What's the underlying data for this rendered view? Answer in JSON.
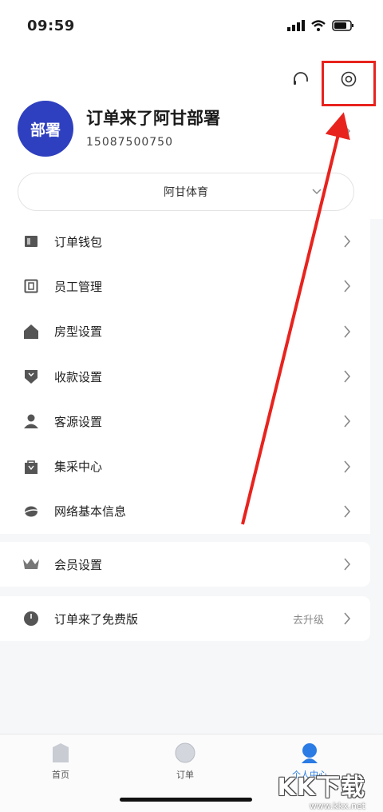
{
  "status_bar": {
    "time": "09:59"
  },
  "profile": {
    "avatar_text": "部署",
    "name": "订单来了阿甘部署",
    "phone": "15087500750",
    "store": "阿甘体育"
  },
  "menu": [
    {
      "id": "wallet",
      "label": "订单钱包",
      "icon": "wallet-icon"
    },
    {
      "id": "staff",
      "label": "员工管理",
      "icon": "staff-icon"
    },
    {
      "id": "room-type",
      "label": "房型设置",
      "icon": "house-icon"
    },
    {
      "id": "payment",
      "label": "收款设置",
      "icon": "payment-icon"
    },
    {
      "id": "customer",
      "label": "客源设置",
      "icon": "person-icon"
    },
    {
      "id": "purchase",
      "label": "集采中心",
      "icon": "bag-icon"
    },
    {
      "id": "network-info",
      "label": "网络基本信息",
      "icon": "globe-icon"
    }
  ],
  "member": {
    "label": "会员设置",
    "icon": "crown-icon"
  },
  "version": {
    "label": "订单来了免费版",
    "extra": "去升级",
    "icon": "clock-icon"
  },
  "bottom_nav": [
    {
      "id": "home",
      "label": "首页",
      "active": false
    },
    {
      "id": "orders",
      "label": "订单",
      "active": false
    },
    {
      "id": "profile",
      "label": "个人中心",
      "active": true
    }
  ],
  "watermark": {
    "logo": "KK下载",
    "url": "www.kkx.net"
  },
  "colors": {
    "accent": "#2a7be4",
    "avatar": "#2e3fbf",
    "annotation": "#e8231e"
  }
}
